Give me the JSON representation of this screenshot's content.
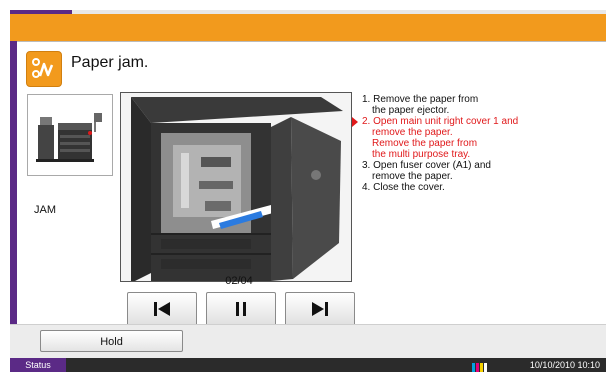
{
  "header": {
    "title": "Paper jam."
  },
  "thumbnail": {
    "label": "JAM"
  },
  "guide": {
    "page_counter": "02/04",
    "current_step": 2
  },
  "steps": [
    {
      "number": "1.",
      "lines": [
        "Remove the paper from",
        "the paper ejector."
      ]
    },
    {
      "number": "2.",
      "lines": [
        "Open main unit right cover 1 and",
        "remove the paper.",
        "Remove the paper from",
        "the multi purpose tray."
      ]
    },
    {
      "number": "3.",
      "lines": [
        "Open fuser cover (A1) and",
        "remove the paper."
      ]
    },
    {
      "number": "4.",
      "lines": [
        "Close the cover."
      ]
    }
  ],
  "controls": {
    "prev_icon": "skip-back-icon",
    "pause_icon": "pause-icon",
    "next_icon": "skip-forward-icon"
  },
  "footer": {
    "hold_label": "Hold"
  },
  "status_bar": {
    "status_label": "Status",
    "datetime": "10/10/2010  10:10"
  },
  "colors": {
    "accent_orange": "#f29a1d",
    "accent_purple": "#5b2a86",
    "highlight_red": "#e0191b"
  }
}
